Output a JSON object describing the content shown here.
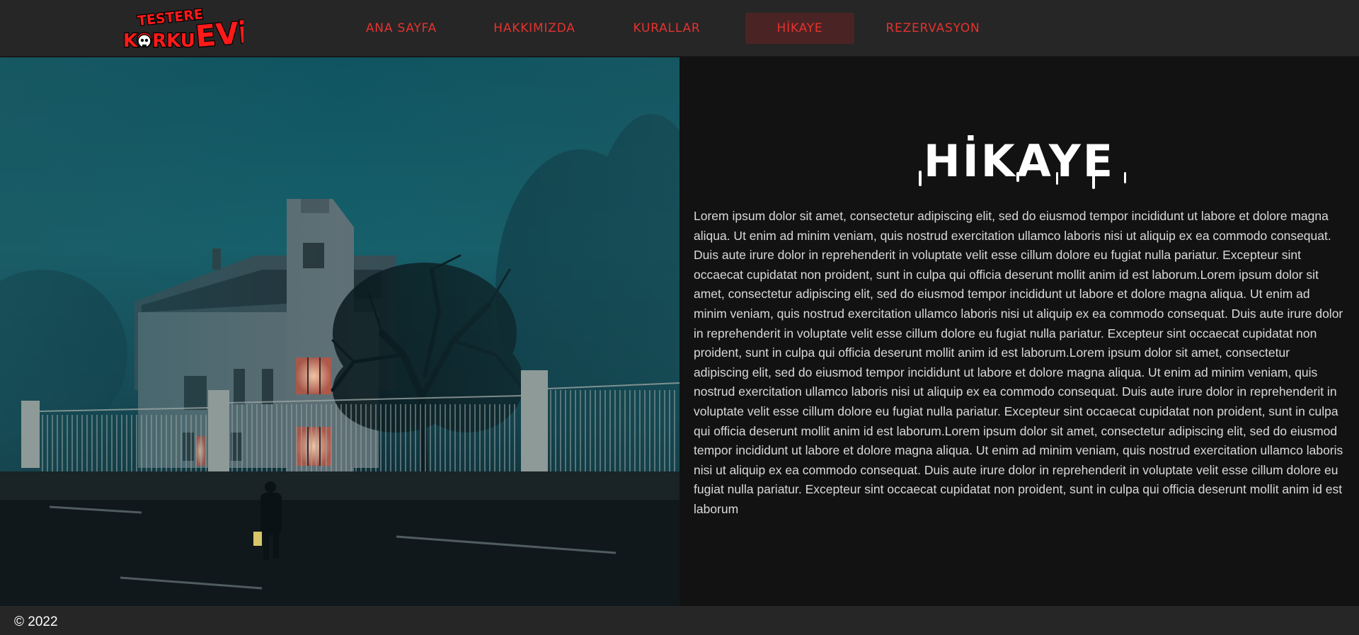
{
  "brand": {
    "logo_line1": "TESTERE",
    "logo_line2": "KORKU",
    "logo_line3": "EVi",
    "accent_color": "#e5322e"
  },
  "nav": {
    "items": [
      {
        "label": "ANA SAYFA",
        "active": false
      },
      {
        "label": "HAKKIMIZDA",
        "active": false
      },
      {
        "label": "KURALLAR",
        "active": false
      },
      {
        "label": "HİKAYE",
        "active": true
      },
      {
        "label": "REZERVASYON",
        "active": false
      }
    ]
  },
  "story": {
    "title": "HİKAYE",
    "body": "Lorem ipsum dolor sit amet, consectetur adipiscing elit, sed do eiusmod tempor incididunt ut labore et dolore magna aliqua. Ut enim ad minim veniam, quis nostrud exercitation ullamco laboris nisi ut aliquip ex ea commodo consequat. Duis aute irure dolor in reprehenderit in voluptate velit esse cillum dolore eu fugiat nulla pariatur. Excepteur sint occaecat cupidatat non proident, sunt in culpa qui officia deserunt mollit anim id est laborum.Lorem ipsum dolor sit amet, consectetur adipiscing elit, sed do eiusmod tempor incididunt ut labore et dolore magna aliqua. Ut enim ad minim veniam, quis nostrud exercitation ullamco laboris nisi ut aliquip ex ea commodo consequat. Duis aute irure dolor in reprehenderit in voluptate velit esse cillum dolore eu fugiat nulla pariatur. Excepteur sint occaecat cupidatat non proident, sunt in culpa qui officia deserunt mollit anim id est laborum.Lorem ipsum dolor sit amet, consectetur adipiscing elit, sed do eiusmod tempor incididunt ut labore et dolore magna aliqua. Ut enim ad minim veniam, quis nostrud exercitation ullamco laboris nisi ut aliquip ex ea commodo consequat. Duis aute irure dolor in reprehenderit in voluptate velit esse cillum dolore eu fugiat nulla pariatur. Excepteur sint occaecat cupidatat non proident, sunt in culpa qui officia deserunt mollit anim id est laborum.Lorem ipsum dolor sit amet, consectetur adipiscing elit, sed do eiusmod tempor incididunt ut labore et dolore magna aliqua. Ut enim ad minim veniam, quis nostrud exercitation ullamco laboris nisi ut aliquip ex ea commodo consequat. Duis aute irure dolor in reprehenderit in voluptate velit esse cillum dolore eu fugiat nulla pariatur. Excepteur sint occaecat cupidatat non proident, sunt in culpa qui officia deserunt mollit anim id est laborum"
  },
  "footer": {
    "copyright": "© 2022"
  }
}
